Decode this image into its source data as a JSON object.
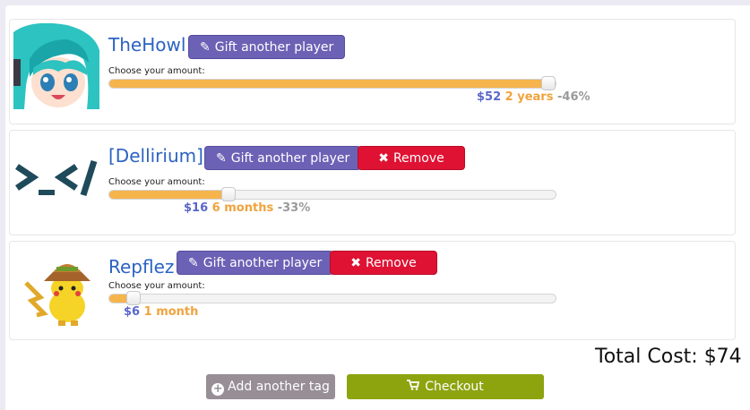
{
  "cards": [
    {
      "name": "TheHowl",
      "gift_label": "Gift another player",
      "remove_label": null,
      "choose_label": "Choose your amount:",
      "slider_fraction": 1.0,
      "price": "$52",
      "duration": "2 years",
      "discount": "-46%"
    },
    {
      "name": "[Dellirium]",
      "gift_label": "Gift another player",
      "remove_label": "Remove",
      "choose_label": "Choose your amount:",
      "slider_fraction": 0.26,
      "price": "$16",
      "duration": "6 months",
      "discount": "-33%"
    },
    {
      "name": "Repflez",
      "gift_label": "Gift another player",
      "remove_label": "Remove",
      "choose_label": "Choose your amount:",
      "slider_fraction": 0.04,
      "price": "$6",
      "duration": "1 month",
      "discount": ""
    }
  ],
  "total_label": "Total Cost: $74",
  "add_tag_label": "Add another tag",
  "checkout_label": "Checkout",
  "icons": {
    "gift": "pencil-square-icon",
    "remove": "x-icon",
    "add": "plus-circle-icon",
    "checkout": "cart-icon"
  },
  "colors": {
    "gift_button": "#6b61b5",
    "remove_button": "#df1233",
    "slider_fill": "#f6b44c",
    "price": "#5a67c9",
    "duration": "#f0a33c",
    "discount": "#9a9a9a",
    "add_button": "#978e96",
    "checkout_button": "#8da40f",
    "name": "#2b63c2"
  }
}
